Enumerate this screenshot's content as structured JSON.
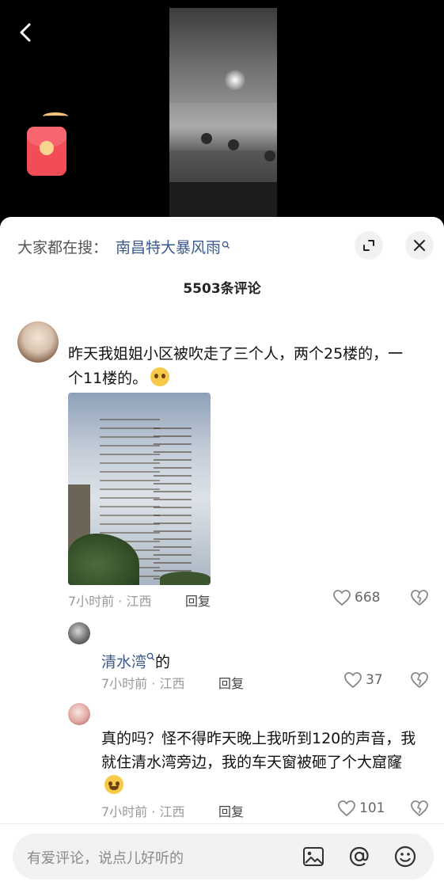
{
  "search": {
    "prefix": "大家都在搜：",
    "term": "南昌特大暴风雨",
    "term_icon": "search-icon"
  },
  "comments_header": {
    "count_label": "5503条评论"
  },
  "comment": {
    "text_before_emoji": "昨天我姐姐小区被吹走了三个人，两个25楼的，一个11楼的。",
    "emoji": "pleading-face-emoji",
    "time_location": "7小时前 · 江西",
    "reply_label": "回复",
    "likes": "668"
  },
  "replies": [
    {
      "user": "清水湾",
      "user_icon": "search-icon",
      "text": "的",
      "time_location": "7小时前 · 江西",
      "reply_label": "回复",
      "likes": "37"
    },
    {
      "text": "真的吗？怪不得昨天晚上我听到120的声音，我就住清水湾旁边，我的车天窗被砸了个大窟窿",
      "emoji": "laughing-tears-emoji",
      "time_location": "7小时前 · 江西",
      "reply_label": "回复",
      "likes": "101"
    }
  ],
  "input": {
    "placeholder": "有爱评论，说点儿好听的"
  },
  "colors": {
    "link_blue": "#3a5a8c",
    "meta_gray": "#9a9a9a",
    "sheet_bg": "#ffffff",
    "video_bg": "#000000"
  }
}
